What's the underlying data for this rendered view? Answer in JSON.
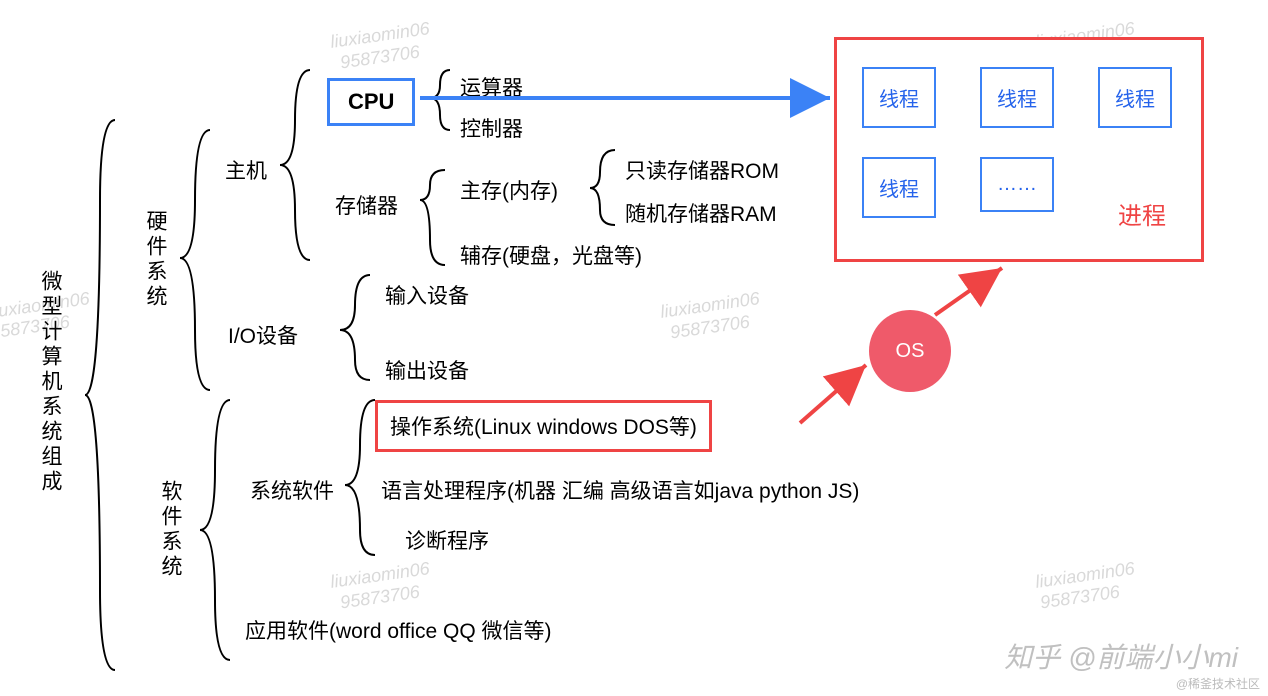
{
  "root": "微型计算机系统组成",
  "hardware": {
    "label": "硬件系统",
    "host": {
      "label": "主机",
      "cpu": {
        "label": "CPU",
        "alu": "运算器",
        "cu": "控制器"
      },
      "storage": {
        "label": "存储器",
        "main": {
          "label": "主存(内存)",
          "rom": "只读存储器ROM",
          "ram": "随机存储器RAM"
        },
        "aux": "辅存(硬盘，光盘等)"
      }
    },
    "io": {
      "label": "I/O设备",
      "in": "输入设备",
      "out": "输出设备"
    }
  },
  "software": {
    "label": "软件系统",
    "system": {
      "label": "系统软件",
      "os": "操作系统(Linux windows DOS等)",
      "lang": "语言处理程序(机器 汇编 高级语言如java python JS)",
      "diag": "诊断程序"
    },
    "app": "应用软件(word office QQ 微信等)"
  },
  "process": {
    "thread": "线程",
    "ellipsis": "……",
    "label": "进程",
    "os": "OS"
  },
  "watermark": {
    "name": "liuxiaomin06",
    "num": "95873706"
  },
  "credit": "知乎 @前端小小mi",
  "credit2": "@稀釜技术社区"
}
